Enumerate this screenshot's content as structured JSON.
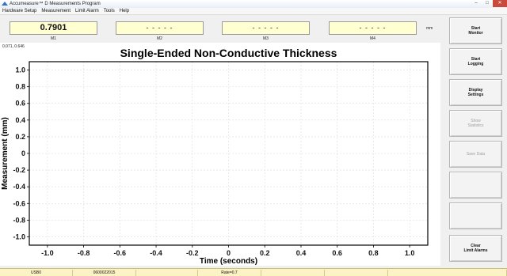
{
  "window": {
    "title": "Accumeasure™ D Measurements Program",
    "controls": [
      "–",
      "□",
      "✕"
    ]
  },
  "menu": [
    "Hardware Setup",
    "Measurement",
    "Limit Alarm",
    "Tools",
    "Help"
  ],
  "measurements": [
    {
      "label": "M1",
      "value": "0.7901"
    },
    {
      "label": "M2",
      "value": "- - - - -"
    },
    {
      "label": "M3",
      "value": "- - - - -"
    },
    {
      "label": "M4",
      "value": "- - - - -"
    }
  ],
  "unit_label": "mm",
  "cursor_readout": "0.071, 0.646",
  "sidebar_buttons": [
    {
      "label": "Start\nMonitor",
      "enabled": true
    },
    {
      "label": "Start\nLogging",
      "enabled": true
    },
    {
      "label": "Display\nSettings",
      "enabled": true
    },
    {
      "label": "Show\nStatistics",
      "enabled": false
    },
    {
      "label": "Save Data",
      "enabled": false
    },
    {
      "label": "",
      "enabled": true
    },
    {
      "label": "",
      "enabled": true
    },
    {
      "label": "Clear\nLimit Alarms",
      "enabled": true
    }
  ],
  "status_bar": [
    "USB0",
    "0600022015",
    "",
    "Rate=0.7",
    "",
    "",
    ""
  ],
  "colors": {
    "measurement_bg": "#ffffd2",
    "statusbar_bg": "#fbf3c3",
    "plot_border": "#000000",
    "grid": "#dddddd"
  },
  "chart_data": {
    "type": "line",
    "title": "Single-Ended Non-Conductive Thickness",
    "xlabel": "Time (seconds)",
    "ylabel": "Measurement (mm)",
    "xlim": [
      -1.1,
      1.1
    ],
    "ylim": [
      -1.1,
      1.1
    ],
    "x_ticks": [
      "-1.0",
      "-0.8",
      "-0.6",
      "-0.4",
      "-0.2",
      "0",
      "0.2",
      "0.4",
      "0.6",
      "0.8",
      "1.0"
    ],
    "y_ticks": [
      "1.0",
      "0.8",
      "0.6",
      "0.4",
      "0.2",
      "0",
      "-0.2",
      "-0.4",
      "-0.6",
      "-0.8",
      "-1.0"
    ],
    "grid": true,
    "series": []
  }
}
